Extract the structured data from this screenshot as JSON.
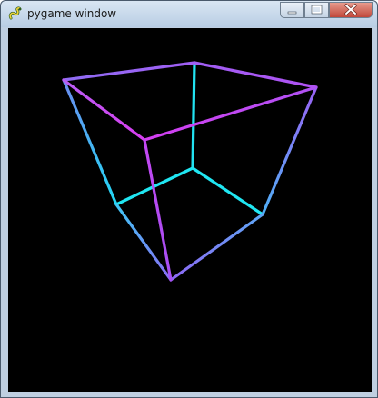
{
  "window": {
    "title": "pygame window",
    "app_icon": "pygame-snake-icon",
    "controls": [
      "minimize",
      "maximize",
      "close"
    ]
  },
  "canvas": {
    "background": "#000000",
    "scene": "wireframe-cube",
    "edge_colors": {
      "cyan": "#20e6f2",
      "blue": "#5aa8f5",
      "violet": "#a255f5",
      "magenta": "#d63af0"
    }
  }
}
